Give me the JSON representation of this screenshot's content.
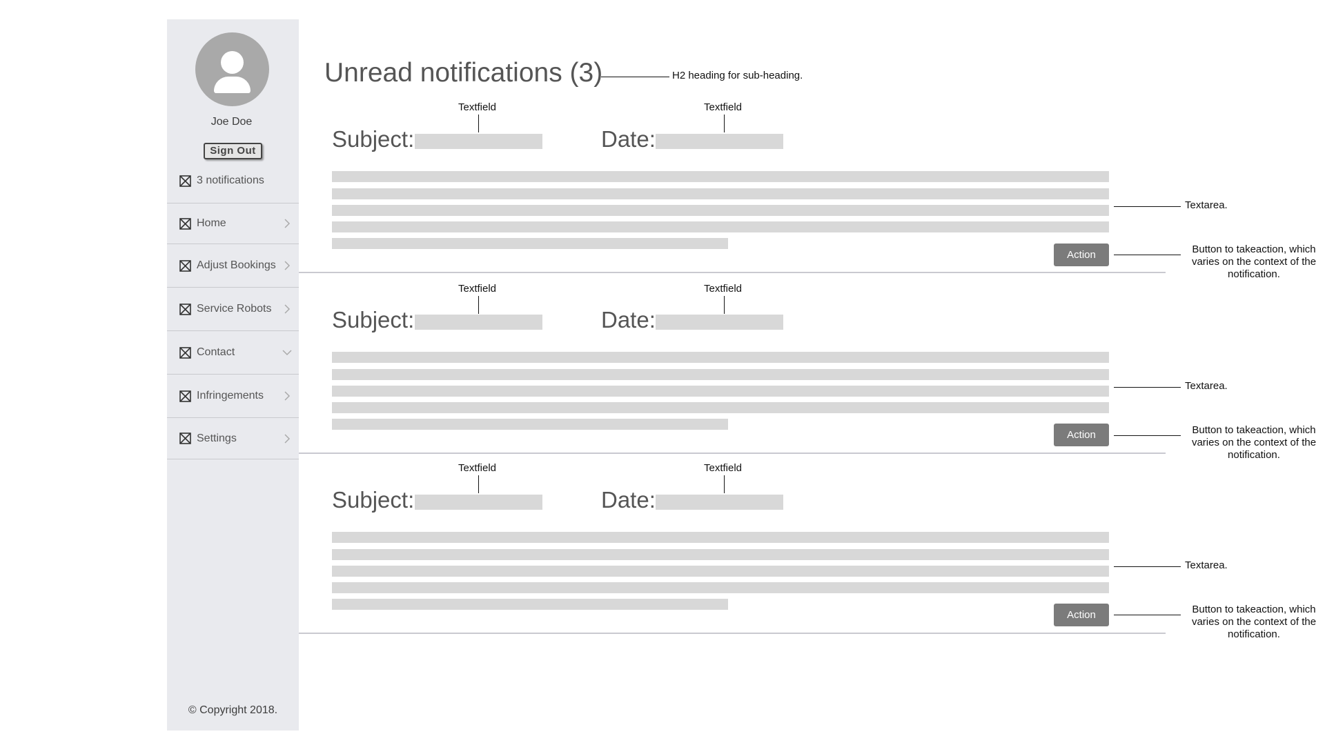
{
  "sidebar": {
    "user_name": "Joe Doe",
    "sign_out_label": "Sign Out",
    "notifications_label": "3 notifications",
    "nav_items": [
      {
        "label": "Home",
        "chevron": "right"
      },
      {
        "label": "Adjust Bookings",
        "chevron": "right"
      },
      {
        "label": "Service Robots",
        "chevron": "right"
      },
      {
        "label": "Contact",
        "chevron": "down"
      },
      {
        "label": "Infringements",
        "chevron": "right"
      },
      {
        "label": "Settings",
        "chevron": "right"
      }
    ],
    "copyright": "© Copyright 2018."
  },
  "main": {
    "heading": "Unread notifications (3)",
    "heading_annotation": "H2 heading for sub-heading.",
    "notifications": [
      {
        "subject_label": "Subject:",
        "date_label": "Date:",
        "subject_annotation": "Textfield",
        "date_annotation": "Textfield",
        "action_label": "Action",
        "textarea_annotation": "Textarea.",
        "button_annotation": "Button to takeaction, which varies on the context of the notification."
      },
      {
        "subject_label": "Subject:",
        "date_label": "Date:",
        "subject_annotation": "Textfield",
        "date_annotation": "Textfield",
        "action_label": "Action",
        "textarea_annotation": "Textarea.",
        "button_annotation": "Button to takeaction, which varies on the context of the notification."
      },
      {
        "subject_label": "Subject:",
        "date_label": "Date:",
        "subject_annotation": "Textfield",
        "date_annotation": "Textfield",
        "action_label": "Action",
        "textarea_annotation": "Textarea.",
        "button_annotation": "Button to takeaction, which varies on the context of the notification."
      }
    ]
  },
  "colors": {
    "sidebar_bg": "#e9eaee",
    "placeholder_gray": "#d8d8d8",
    "button_gray": "#7b7b7b",
    "avatar_gray": "#a9a9a9"
  },
  "icons": [
    "user-avatar-icon",
    "image-placeholder-icon",
    "chevron-right-icon",
    "chevron-down-icon"
  ]
}
